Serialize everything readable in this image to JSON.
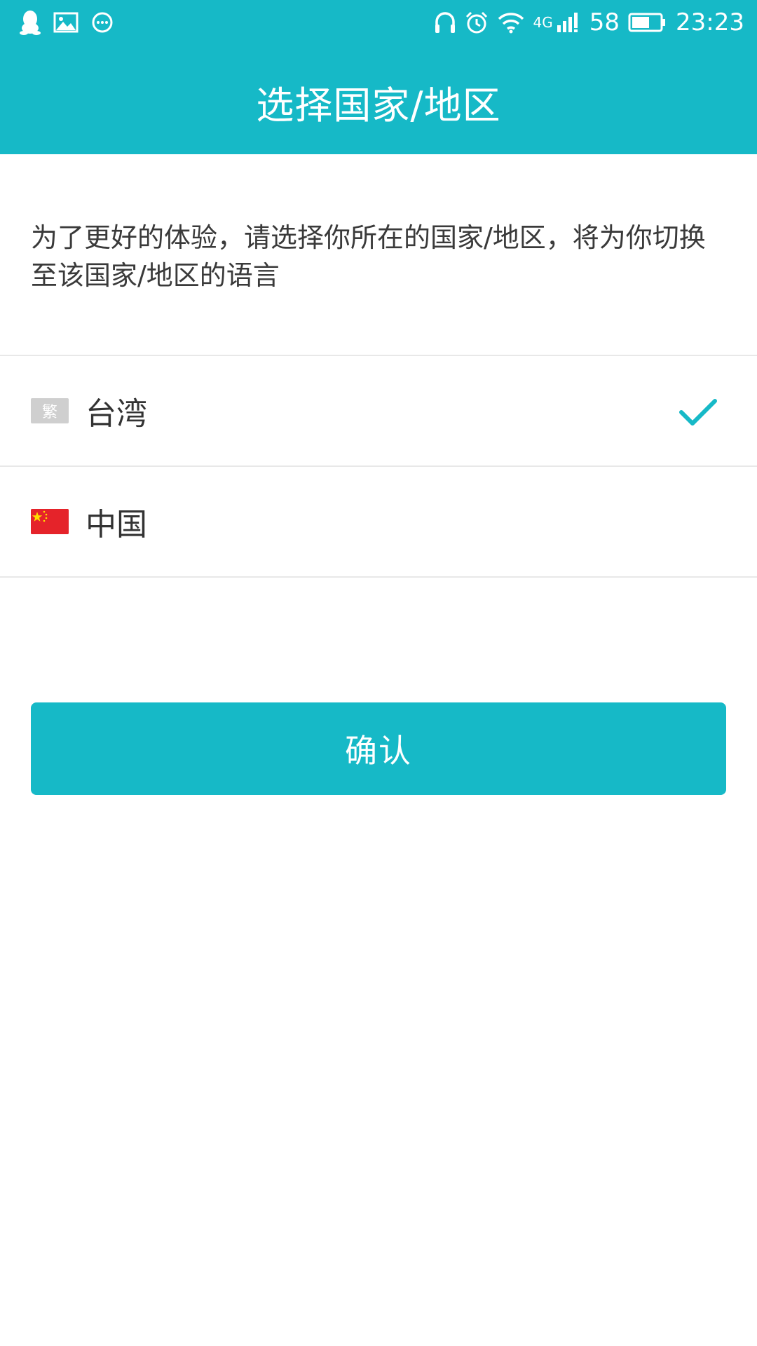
{
  "status_bar": {
    "network": "4G",
    "battery": "58",
    "time": "23:23",
    "left_icons": [
      "qq-icon",
      "gallery-icon",
      "chat-bubble-icon"
    ],
    "right_icons": [
      "headphones-icon",
      "alarm-icon",
      "wifi-icon",
      "signal-icon",
      "battery-icon"
    ]
  },
  "header": {
    "title": "选择国家/地区"
  },
  "description": "为了更好的体验，请选择你所在的国家/地区，将为你切换至该国家/地区的语言",
  "regions": [
    {
      "flag_label": "繁",
      "label": "台湾",
      "selected": true
    },
    {
      "flag_label": "",
      "label": "中国",
      "selected": false
    }
  ],
  "confirm_button": {
    "label": "确认"
  },
  "colors": {
    "accent": "#16b9c7",
    "text": "#333333",
    "divider": "#e8e8e8",
    "cn_flag_red": "#e5232a",
    "cn_flag_star": "#ffde00"
  }
}
